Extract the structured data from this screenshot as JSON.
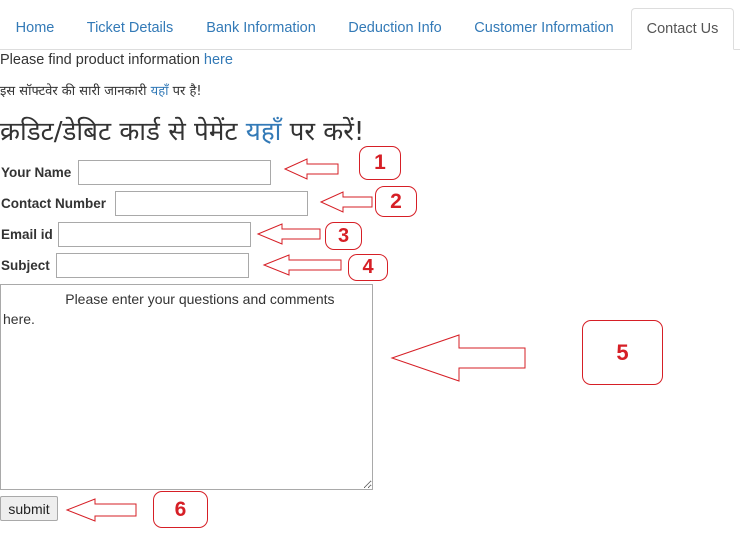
{
  "tabs": [
    {
      "label": "Home"
    },
    {
      "label": "Ticket Details"
    },
    {
      "label": "Bank Information"
    },
    {
      "label": "Deduction Info"
    },
    {
      "label": "Customer Information"
    },
    {
      "label": "Contact Us",
      "active": true
    }
  ],
  "intro": {
    "text": "Please find product information ",
    "link": "here"
  },
  "hindi_info": {
    "text": "इस सॉफ्टवेर की सारी जानकारी ",
    "link": "यहाँ",
    "suffix": " पर है!"
  },
  "payment_heading": {
    "text": "क्रडिट/डेबिट कार्ड से पेमेंट ",
    "link": "यहाँ",
    "suffix": " पर करें!"
  },
  "form": {
    "name_label": "Your Name",
    "name_value": "",
    "contact_label": "Contact Number",
    "contact_value": "",
    "email_label": "Email id",
    "email_value": "",
    "subject_label": "Subject",
    "subject_value": "",
    "comments_value": "                Please enter your questions and comments here.",
    "submit_label": "submit"
  },
  "callouts": [
    "1",
    "2",
    "3",
    "4",
    "5",
    "6"
  ],
  "annotation_color": "#d61f26",
  "link_color": "#337ab7"
}
